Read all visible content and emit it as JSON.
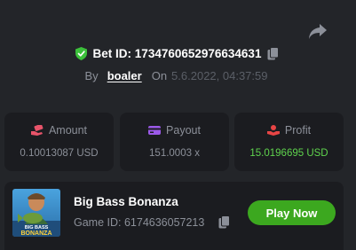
{
  "bet": {
    "id_label": "Bet ID: 173476065297663463​1",
    "by_label": "By",
    "username": "boaler",
    "on_label": "On",
    "date": "5.6.2022, 04:37:59"
  },
  "stats": [
    {
      "label": "Amount",
      "value": "0.10013087 USD",
      "icon": "money-hand-icon"
    },
    {
      "label": "Payout",
      "value": "151.0003 x",
      "icon": "card-icon"
    },
    {
      "label": "Profit",
      "value": "15.0196695 USD",
      "icon": "profit-hand-icon"
    }
  ],
  "game": {
    "title": "Big Bass Bonanza",
    "id_label": "Game ID: 6174636057213",
    "play_label": "Play Now",
    "thumb_text_top": "BIG BASS",
    "thumb_text_bottom": "BONANZA"
  },
  "colors": {
    "background": "#232529",
    "card": "#1b1c20",
    "accent_green": "#3ca81f",
    "profit_green": "#5fd34d",
    "amount_icon": "#e8546a",
    "payout_icon": "#9b59e8",
    "profit_icon": "#e84545"
  }
}
